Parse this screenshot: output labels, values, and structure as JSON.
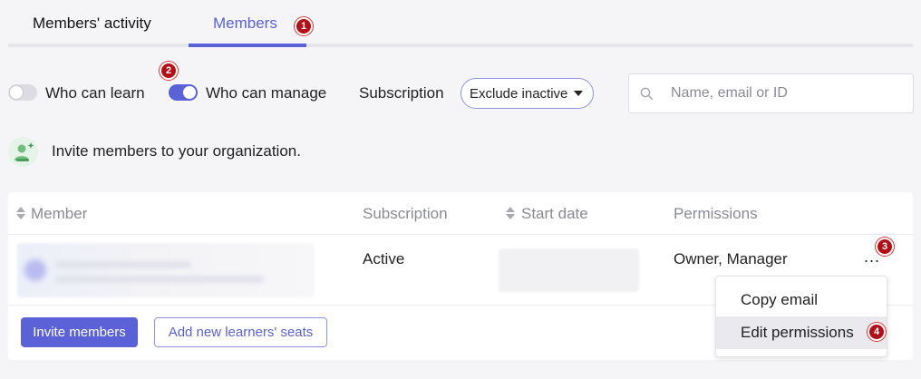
{
  "tabs": [
    {
      "label": "Members' activity",
      "active": false
    },
    {
      "label": "Members",
      "active": true
    }
  ],
  "markers": [
    "1",
    "2",
    "3",
    "4"
  ],
  "filters": {
    "who_can_learn": {
      "label": "Who can learn",
      "on": false
    },
    "who_can_manage": {
      "label": "Who can manage",
      "on": true
    },
    "subscription_label": "Subscription",
    "subscription_value": "Exclude inactive"
  },
  "search": {
    "placeholder": "Name, email or ID",
    "value": ""
  },
  "invite": {
    "text": "Invite members to your organization."
  },
  "table": {
    "headers": [
      "Member",
      "Subscription",
      "Start date",
      "Permissions"
    ],
    "rows": [
      {
        "subscription": "Active",
        "permissions": "Owner, Manager",
        "more": "..."
      }
    ]
  },
  "buttons": {
    "invite_members": "Invite members",
    "add_seats": "Add new learners' seats"
  },
  "context_menu": {
    "items": [
      "Copy email",
      "Edit permissions"
    ],
    "highlighted": "Edit permissions"
  },
  "colors": {
    "accent": "#5b61d6",
    "badge": "#b30f16",
    "background": "#f5f5f7"
  }
}
